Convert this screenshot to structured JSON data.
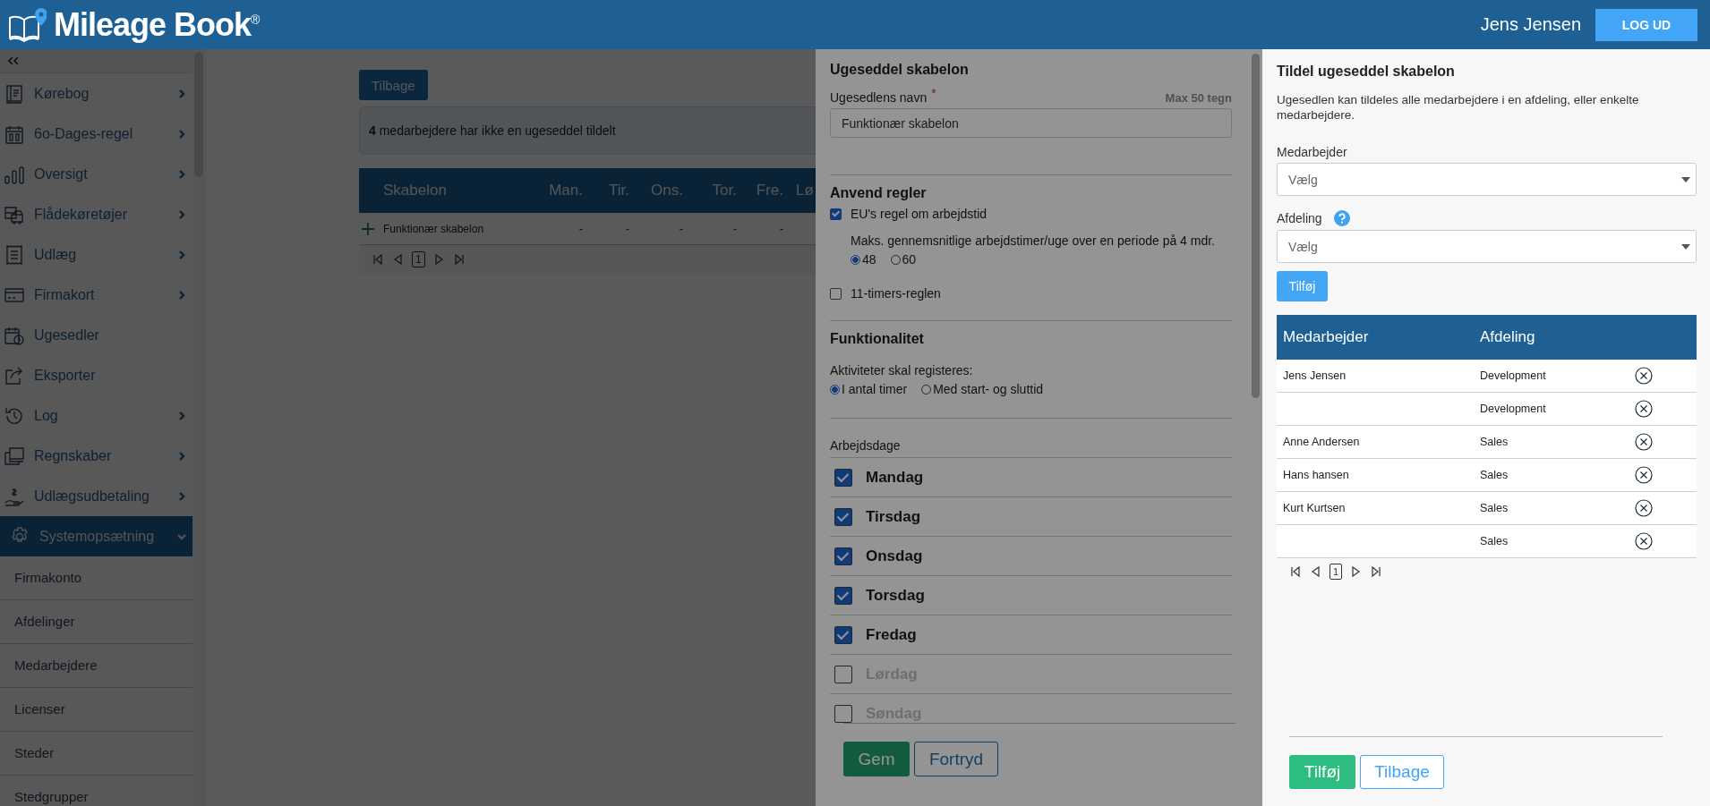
{
  "header": {
    "logo": "Mileage Book$^{®}$",
    "user": "Jens Jensen",
    "logout": "LOG UD"
  },
  "sidebar": {
    "items": [
      {
        "label": "Kørebog",
        "kind": "group",
        "expanded": false,
        "selected": false
      },
      {
        "label": "6o-Dages-regel",
        "kind": "group",
        "expanded": false,
        "selected": false
      },
      {
        "label": "Oversigt",
        "kind": "group",
        "expanded": false,
        "selected": false
      },
      {
        "label": "Flådekøretøjer",
        "kind": "group",
        "expanded": false,
        "selected": false
      },
      {
        "label": "Udlæg",
        "kind": "group",
        "expanded": false,
        "selected": false
      },
      {
        "label": "Firmakort",
        "kind": "group",
        "expanded": false,
        "selected": false
      },
      {
        "label": "Ugesedler",
        "kind": "link",
        "selected": false
      },
      {
        "label": "Eksporter",
        "kind": "link",
        "selected": false
      },
      {
        "label": "Log",
        "kind": "group",
        "expanded": false,
        "selected": false
      },
      {
        "label": "Regnskaber",
        "kind": "group",
        "expanded": false,
        "selected": false
      },
      {
        "label": "Udlægsudbetaling",
        "kind": "group",
        "expanded": false,
        "selected": false
      },
      {
        "label": "Systemopsætning",
        "kind": "group",
        "expanded": true,
        "selected": true,
        "children": [
          {
            "label": "Firmakonto"
          },
          {
            "label": "Afdelinger"
          },
          {
            "label": "Medarbejdere"
          },
          {
            "label": "Licenser"
          },
          {
            "label": "Steder"
          },
          {
            "label": "Stedgrupper"
          }
        ]
      }
    ]
  },
  "main": {
    "back_button": "Tilbage",
    "notice": "**4** medarbejdere har ikke en ugeseddel tildelt",
    "table": {
      "columns": [
        "Skabelon",
        "Man.",
        "Tir.",
        "Ons.",
        "Tor.",
        "Fre.",
        "Lø"
      ],
      "rows": [
        {
          "cells": [
            "Funktionær skabelon",
            "-",
            "-",
            "-",
            "-",
            "-"
          ]
        }
      ]
    },
    "pager": {
      "page": "1"
    }
  },
  "template_panel": {
    "title": "Ugeseddel skabelon",
    "name_field": {
      "label": "Ugesedlens navn",
      "required_mark": "*",
      "hint": "Max 50 tegn",
      "value": "Funktionær skabelon"
    },
    "rules": {
      "heading": "Anvend regler",
      "eu_rule": {
        "label": "EU's regel om arbejdstid",
        "checked": true
      },
      "max_hours_text": "Maks. gennemsnitlige arbejdstimer/uge over en periode på 4 mdr.",
      "hour_options": [
        {
          "label": "48",
          "selected": true
        },
        {
          "label": "60",
          "selected": false
        }
      ],
      "eleven_hour_rule": {
        "label": "11-timers-reglen",
        "checked": false
      }
    },
    "functionality": {
      "heading": "Funktionalitet",
      "prompt": "Aktiviteter skal registeres:",
      "options": [
        {
          "label": "I antal timer",
          "selected": true
        },
        {
          "label": "Med start- og sluttid",
          "selected": false
        }
      ]
    },
    "workdays": {
      "heading": "Arbejdsdage",
      "days": [
        {
          "label": "Mandag",
          "checked": true
        },
        {
          "label": "Tirsdag",
          "checked": true
        },
        {
          "label": "Onsdag",
          "checked": true
        },
        {
          "label": "Torsdag",
          "checked": true
        },
        {
          "label": "Fredag",
          "checked": true
        },
        {
          "label": "Lørdag",
          "checked": false
        },
        {
          "label": "Søndag",
          "checked": false
        }
      ]
    },
    "buttons": {
      "save": "Gem",
      "cancel": "Fortryd"
    }
  },
  "assign_panel": {
    "title": "Tildel ugeseddel skabelon",
    "description": "Ugesedlen kan tildeles alle medarbejdere i en afdeling, eller enkelte medarbejdere.",
    "employee_select": {
      "label": "Medarbejder",
      "placeholder": "Vælg"
    },
    "department_select": {
      "label": "Afdeling",
      "placeholder": "Vælg"
    },
    "add_button": "Tilføj",
    "table": {
      "columns": [
        "Medarbejder",
        "Afdeling"
      ],
      "rows": [
        {
          "employee": "Jens Jensen",
          "department": "Development"
        },
        {
          "department": "Development"
        },
        {
          "employee": "Anne Andersen",
          "department": "Sales"
        },
        {
          "employee": "Hans hansen",
          "department": "Sales"
        },
        {
          "employee": "Kurt Kurtsen",
          "department": "Sales"
        },
        {
          "department": "Sales"
        }
      ]
    },
    "pager": {
      "page": "1"
    },
    "buttons": {
      "add": "Tilføj",
      "back": "Tilbage"
    }
  }
}
